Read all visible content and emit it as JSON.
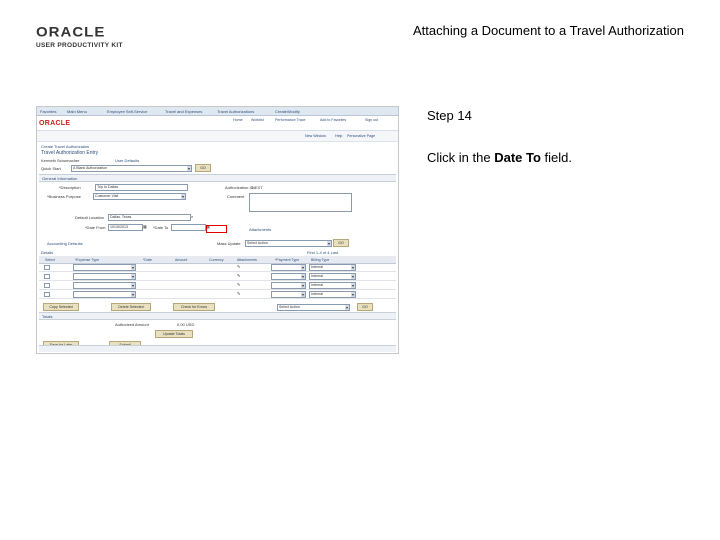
{
  "logo": {
    "brand": "ORACLE",
    "subtitle": "USER PRODUCTIVITY KIT"
  },
  "slide_title": "Attaching a Document to a Travel Authorization",
  "step": "Step 14",
  "instruction": {
    "before": "Click in the ",
    "field": "Date To",
    "after": " field."
  },
  "screenshot": {
    "nav": [
      "Favorites",
      "Main Menu",
      "Employee Self-Service",
      "Travel and Expenses",
      "Travel Authorizations",
      "Create/Modify"
    ],
    "brand": "ORACLE",
    "header_links": [
      "Home",
      "Worklist",
      "Performance Trace",
      "Add to Favorites",
      "Sign out"
    ],
    "subbar_links": [
      "New Window",
      "Help",
      "Personalize Page"
    ],
    "breadcrumb": "Create Travel Authorization",
    "page_title": "Travel Authorization Entry",
    "employee_name": "Kenneth Schumacher",
    "user_defaults": "User Defaults",
    "quick_start_label": "Quick Start",
    "quick_start_value": "A Blank Authorization",
    "go": "GO",
    "general_info": "General Information",
    "description_label": "*Description",
    "description_value": "Trip to Dallas",
    "authorization_id_label": "Authorization ID",
    "authorization_id_value": "NEXT",
    "business_purpose_label": "*Business Purpose",
    "business_purpose_value": "Customer Visit",
    "comment_label": "Comment",
    "default_location_label": "Default Location",
    "default_location_value": "Dallas, Texas",
    "date_from_label": "*Date From",
    "date_from_value": "10/15/2013",
    "date_to_label": "*Date To",
    "attachments_link": "Attachments",
    "accounting_defaults": "Accounting Defaults",
    "mass_update_label": "Mass Update",
    "mass_update_value": "Select Action",
    "details_title": "Details",
    "grid_nav": "First  1-4 of 4  Last",
    "columns": [
      "Select",
      "*Expense Type",
      "*Date",
      "Amount",
      "Currency",
      "Attachments",
      "*Payment Type",
      "Billing Type"
    ],
    "billing_rows": [
      "Internal",
      "Internal",
      "Internal",
      "Internal"
    ],
    "buttons": [
      "Copy Selected",
      "Delete Selected",
      "Check for Errors",
      "Select Action"
    ],
    "totals_title": "Totals",
    "authorized_amount_label": "Authorized Amount",
    "authorized_amount_value": "0.00   USD",
    "update_totals": "Update Totals",
    "save_for_later": "Save for Later",
    "submit": "Submit"
  }
}
